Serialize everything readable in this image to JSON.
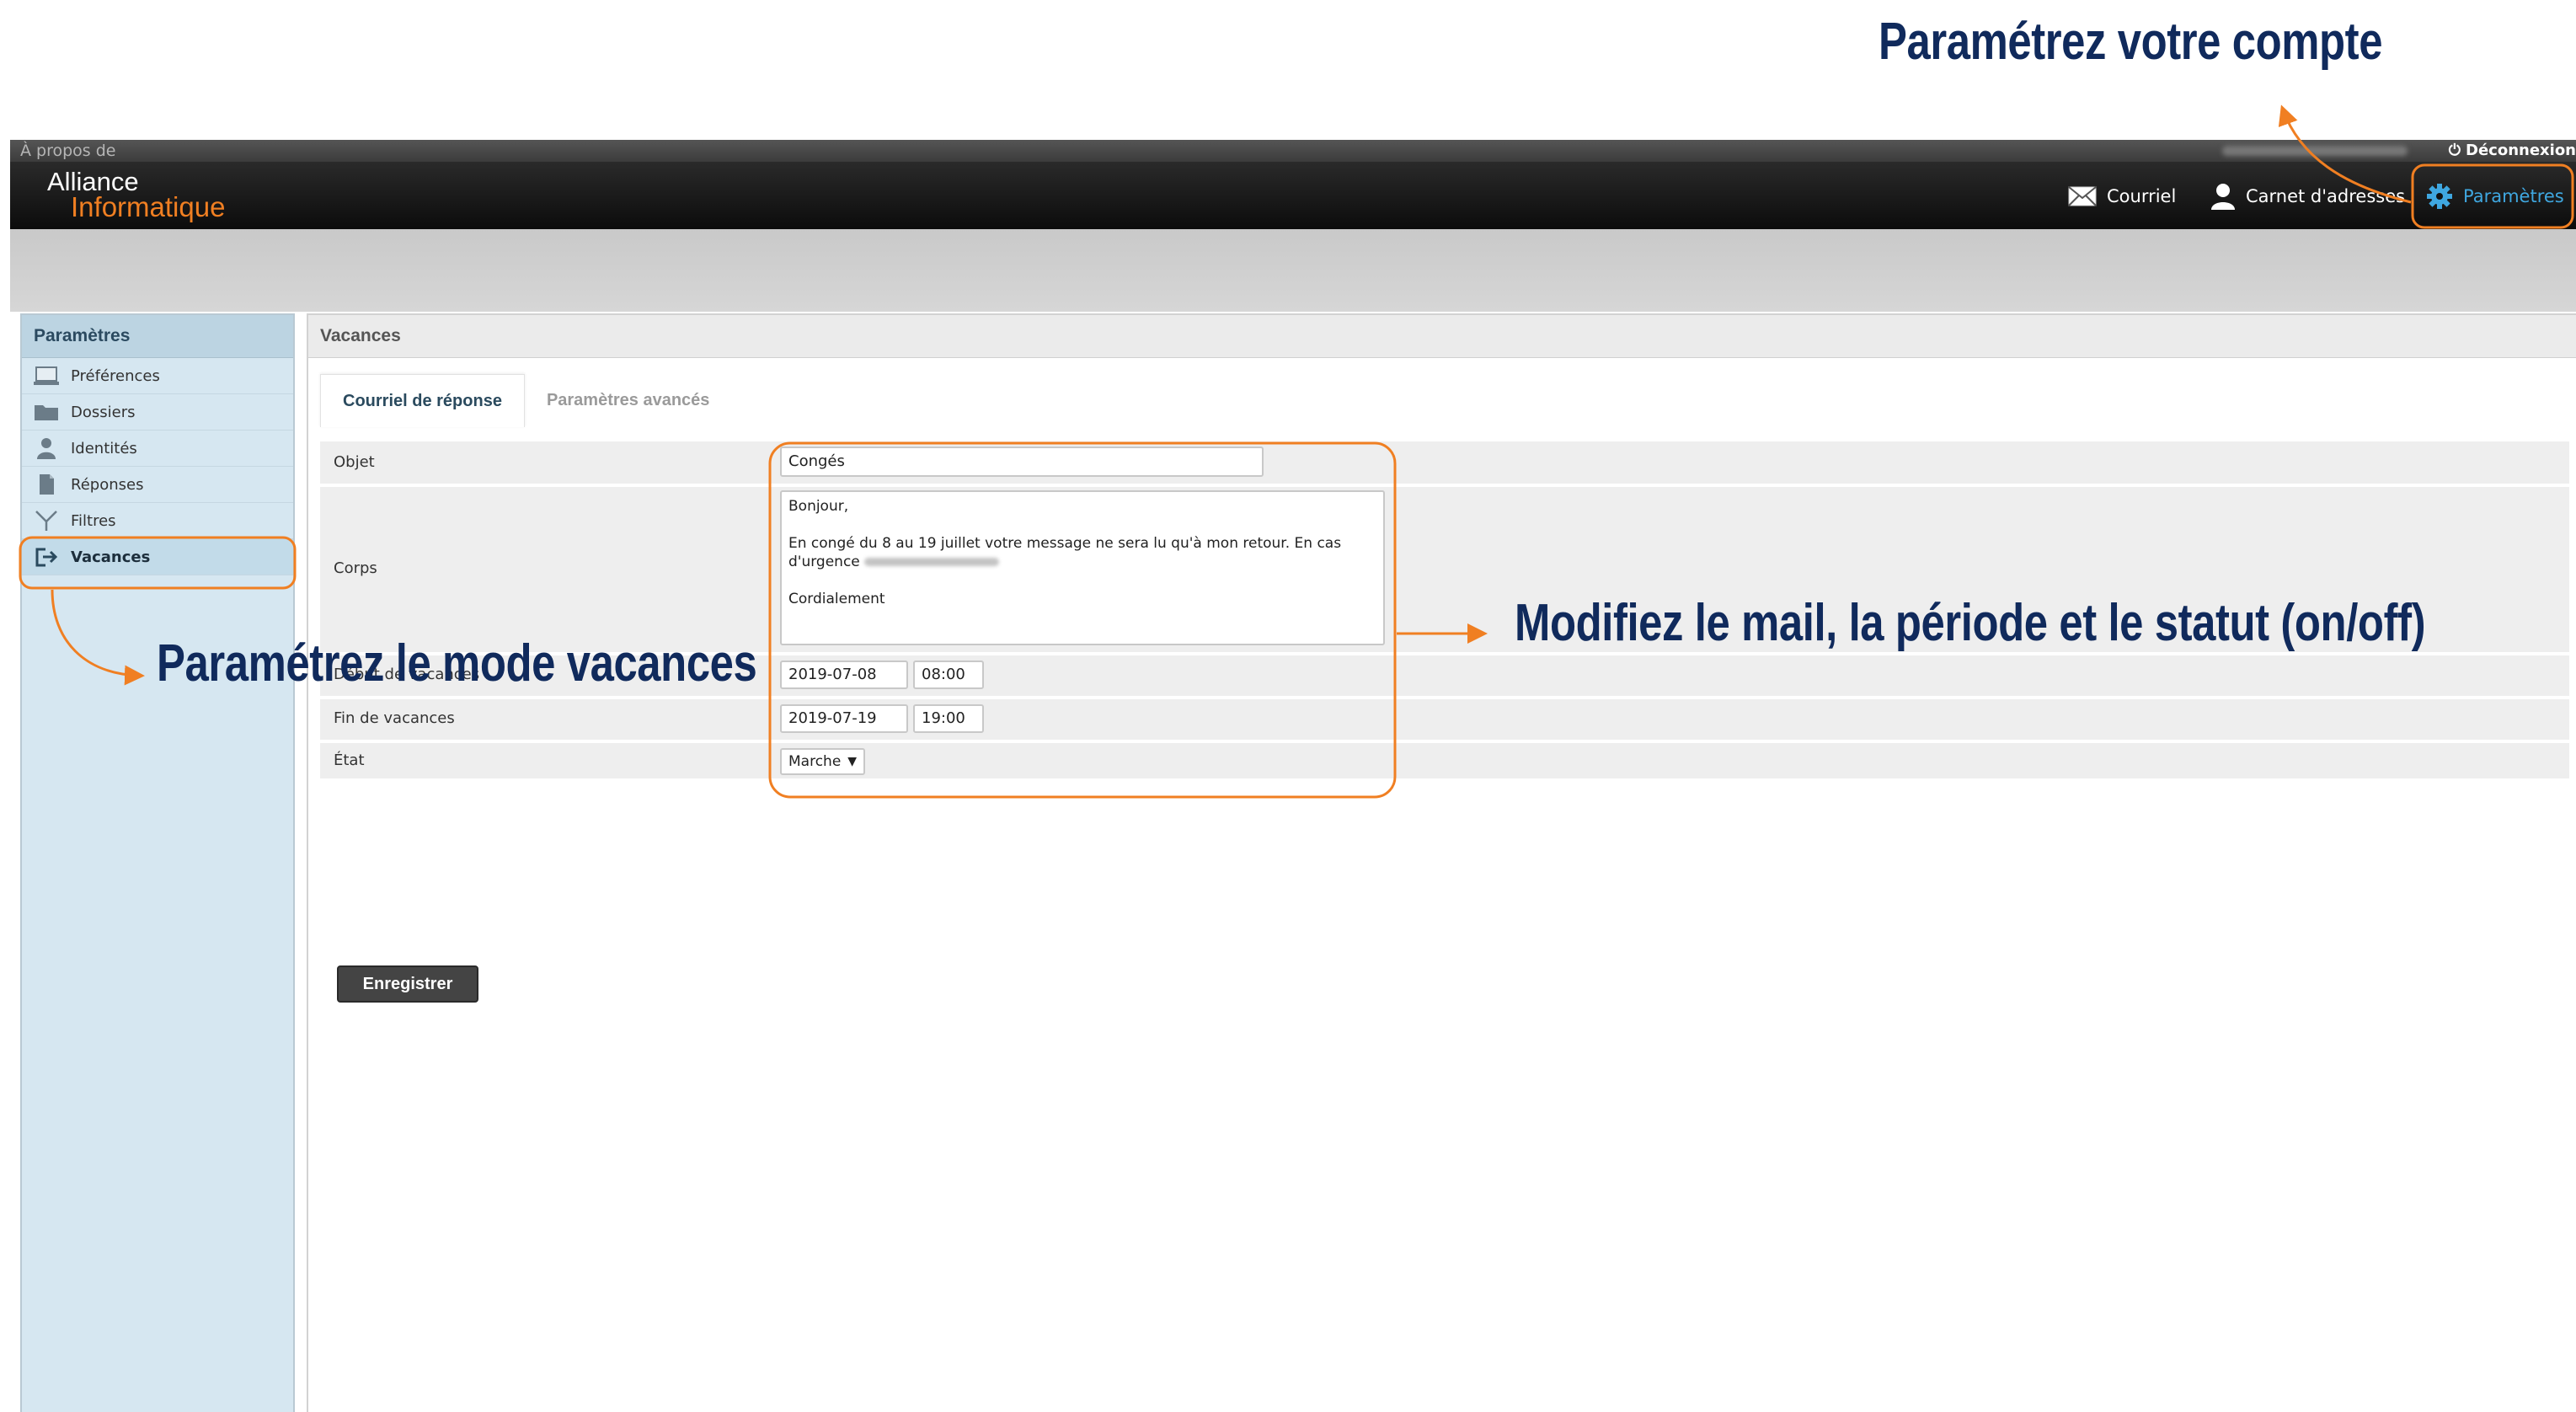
{
  "topbar": {
    "about": "À propos de",
    "logout": "Déconnexion"
  },
  "logo": {
    "line1": "Alliance",
    "line2": "Informatique"
  },
  "nav": {
    "mail": "Courriel",
    "contacts": "Carnet d'adresses",
    "settings": "Paramètres"
  },
  "sidebar": {
    "title": "Paramètres",
    "items": [
      {
        "label": "Préférences",
        "icon": "monitor-icon"
      },
      {
        "label": "Dossiers",
        "icon": "folder-icon"
      },
      {
        "label": "Identités",
        "icon": "person-icon"
      },
      {
        "label": "Réponses",
        "icon": "document-icon"
      },
      {
        "label": "Filtres",
        "icon": "filter-icon"
      },
      {
        "label": "Vacances",
        "icon": "exit-icon",
        "active": true
      }
    ]
  },
  "main": {
    "title": "Vacances",
    "tabs": [
      {
        "label": "Courriel de réponse",
        "active": true
      },
      {
        "label": "Paramètres avancés",
        "active": false
      }
    ],
    "form": {
      "subject_label": "Objet",
      "subject_value": "Congés",
      "body_label": "Corps",
      "body_lines": [
        "Bonjour,",
        "En congé du 8 au 19 juillet votre message ne sera lu qu'à mon retour. En cas d'urgence",
        "Cordialement"
      ],
      "start_label": "Début de vacances",
      "start_date": "2019-07-08",
      "start_time": "08:00",
      "end_label": "Fin de vacances",
      "end_date": "2019-07-19",
      "end_time": "19:00",
      "state_label": "État",
      "state_value": "Marche"
    },
    "save_label": "Enregistrer"
  },
  "annotations": {
    "account": "Paramétrez votre compte",
    "vacation": "Paramétrez le mode vacances",
    "modify": "Modifiez le mail, la période et le statut (on/off)"
  },
  "colors": {
    "accent_orange": "#f07f22",
    "annotation_text": "#102a5c",
    "settings_blue": "#3fa7e0",
    "sidebar_bg": "#d6e7f1"
  }
}
